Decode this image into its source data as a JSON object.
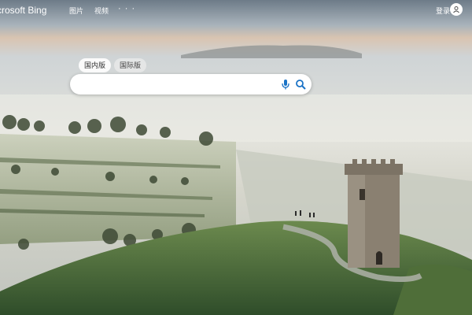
{
  "header": {
    "brand": "crosoft Bing",
    "nav": [
      "图片",
      "视频"
    ],
    "more": "· · ·",
    "login": "登录"
  },
  "search": {
    "tabs": [
      "国内版",
      "国际版"
    ],
    "value": "",
    "placeholder": ""
  },
  "icons": {
    "mic": "microphone-icon",
    "search": "search-icon",
    "user": "user-icon"
  },
  "colors": {
    "accent": "#1a73c6",
    "text_light": "#ffffff"
  }
}
